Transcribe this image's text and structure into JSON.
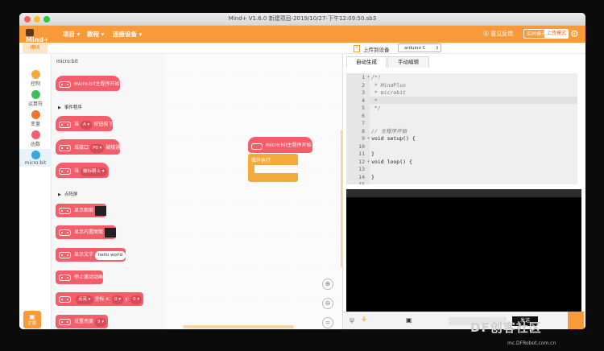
{
  "window": {
    "title": "Mind+ V1.6.0    新建项目-2019/10/27-下午12:09:50.sb3"
  },
  "menubar": {
    "logo": "Mind+",
    "menus": [
      "项目 ▾",
      "教程 ▾",
      "连接设备 ▾"
    ],
    "feedback": "⓪ 意见反馈",
    "realtime_mode": "实时模式",
    "upload_mode": "上传模式"
  },
  "subbar": {
    "modules_tab": "模块"
  },
  "categories": [
    {
      "label": "控制",
      "color": "#f6a93b"
    },
    {
      "label": "运算符",
      "color": "#3fbf5a"
    },
    {
      "label": "变量",
      "color": "#f0742c"
    },
    {
      "label": "函数",
      "color": "#f25f6a"
    },
    {
      "label": "micro:bit",
      "color": "#3aa7e0"
    }
  ],
  "extensions_label": "扩展",
  "palette": {
    "title": "micro:bit",
    "sections": [
      "事件程序",
      "点阵屏"
    ],
    "blocks": {
      "start": "micro:bit主程序开始",
      "when_pressed_1": "当",
      "btn_a": "A ▾",
      "when_pressed_2": "按钮按下",
      "pin_1": "当接口",
      "pin_val": "P0 ▾",
      "pin_2": "被接通",
      "logo": "当",
      "logo_val": "徽标朝上 ▾",
      "show_image": "显示图案",
      "show_builtin": "显示内置图案",
      "show_text": "显示文字",
      "text_val": "hello world",
      "stop_anim": "停止滚动动画",
      "plot_mode": "点亮 ▾",
      "plot_x": "坐标 x:",
      "plot_x_val": "0 ▾",
      "plot_y": "y:",
      "plot_y_val": "0 ▾",
      "brightness": "设置亮度",
      "brightness_val": "9 ▾"
    }
  },
  "canvas": {
    "start_block": "micro:bit主程序开始",
    "loop_block": "循环执行",
    "zoom": [
      "⊕",
      "⊖",
      "="
    ]
  },
  "codepane": {
    "upload_label": "上传到设备",
    "board": "arduino C",
    "tabs": [
      "自动生成",
      "手动编辑"
    ],
    "line_numbers": [
      "1",
      "2",
      "3",
      "4",
      "5",
      "6",
      "7",
      "8",
      "9",
      "10",
      "11",
      "12",
      "13",
      "14",
      "15"
    ],
    "code_lines": [
      "/*!",
      " * MindPlus",
      " * microbit",
      " *",
      " */",
      "",
      "",
      "// 主程序开始",
      "void setup() {",
      "",
      "}",
      "void loop() {",
      "",
      "}",
      ""
    ]
  },
  "serial": {
    "send": "发送"
  },
  "watermark": {
    "brand": "DF创客社区",
    "url": "mc.DFRobot.com.cn"
  }
}
